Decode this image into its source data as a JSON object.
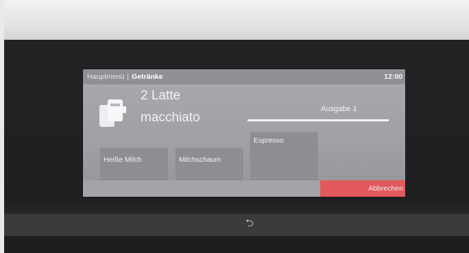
{
  "breadcrumb": {
    "home": "Hauptmenü",
    "separator": "|",
    "current": "Getränke"
  },
  "status": {
    "time": "12:00"
  },
  "drink": {
    "quantity_line": "2 Latte",
    "name_line": "macchiato",
    "icon": "cups-icon"
  },
  "output": {
    "label": "Ausgabe 1",
    "progress_fraction": 1.0
  },
  "tiles": {
    "hot_milk": "Heiße Milch",
    "milk_foam": "Milchschaum",
    "espresso": "Espresso"
  },
  "cancel": {
    "label": "Abbrechen",
    "color": "#e2595c"
  },
  "navigation": {
    "back_icon": "back-arrow-icon",
    "back_glyph": "⮌"
  },
  "colors": {
    "screen_bg": "#a0a1a4",
    "tile_bg": "#8d8e92",
    "accent_red": "#e2595c"
  }
}
